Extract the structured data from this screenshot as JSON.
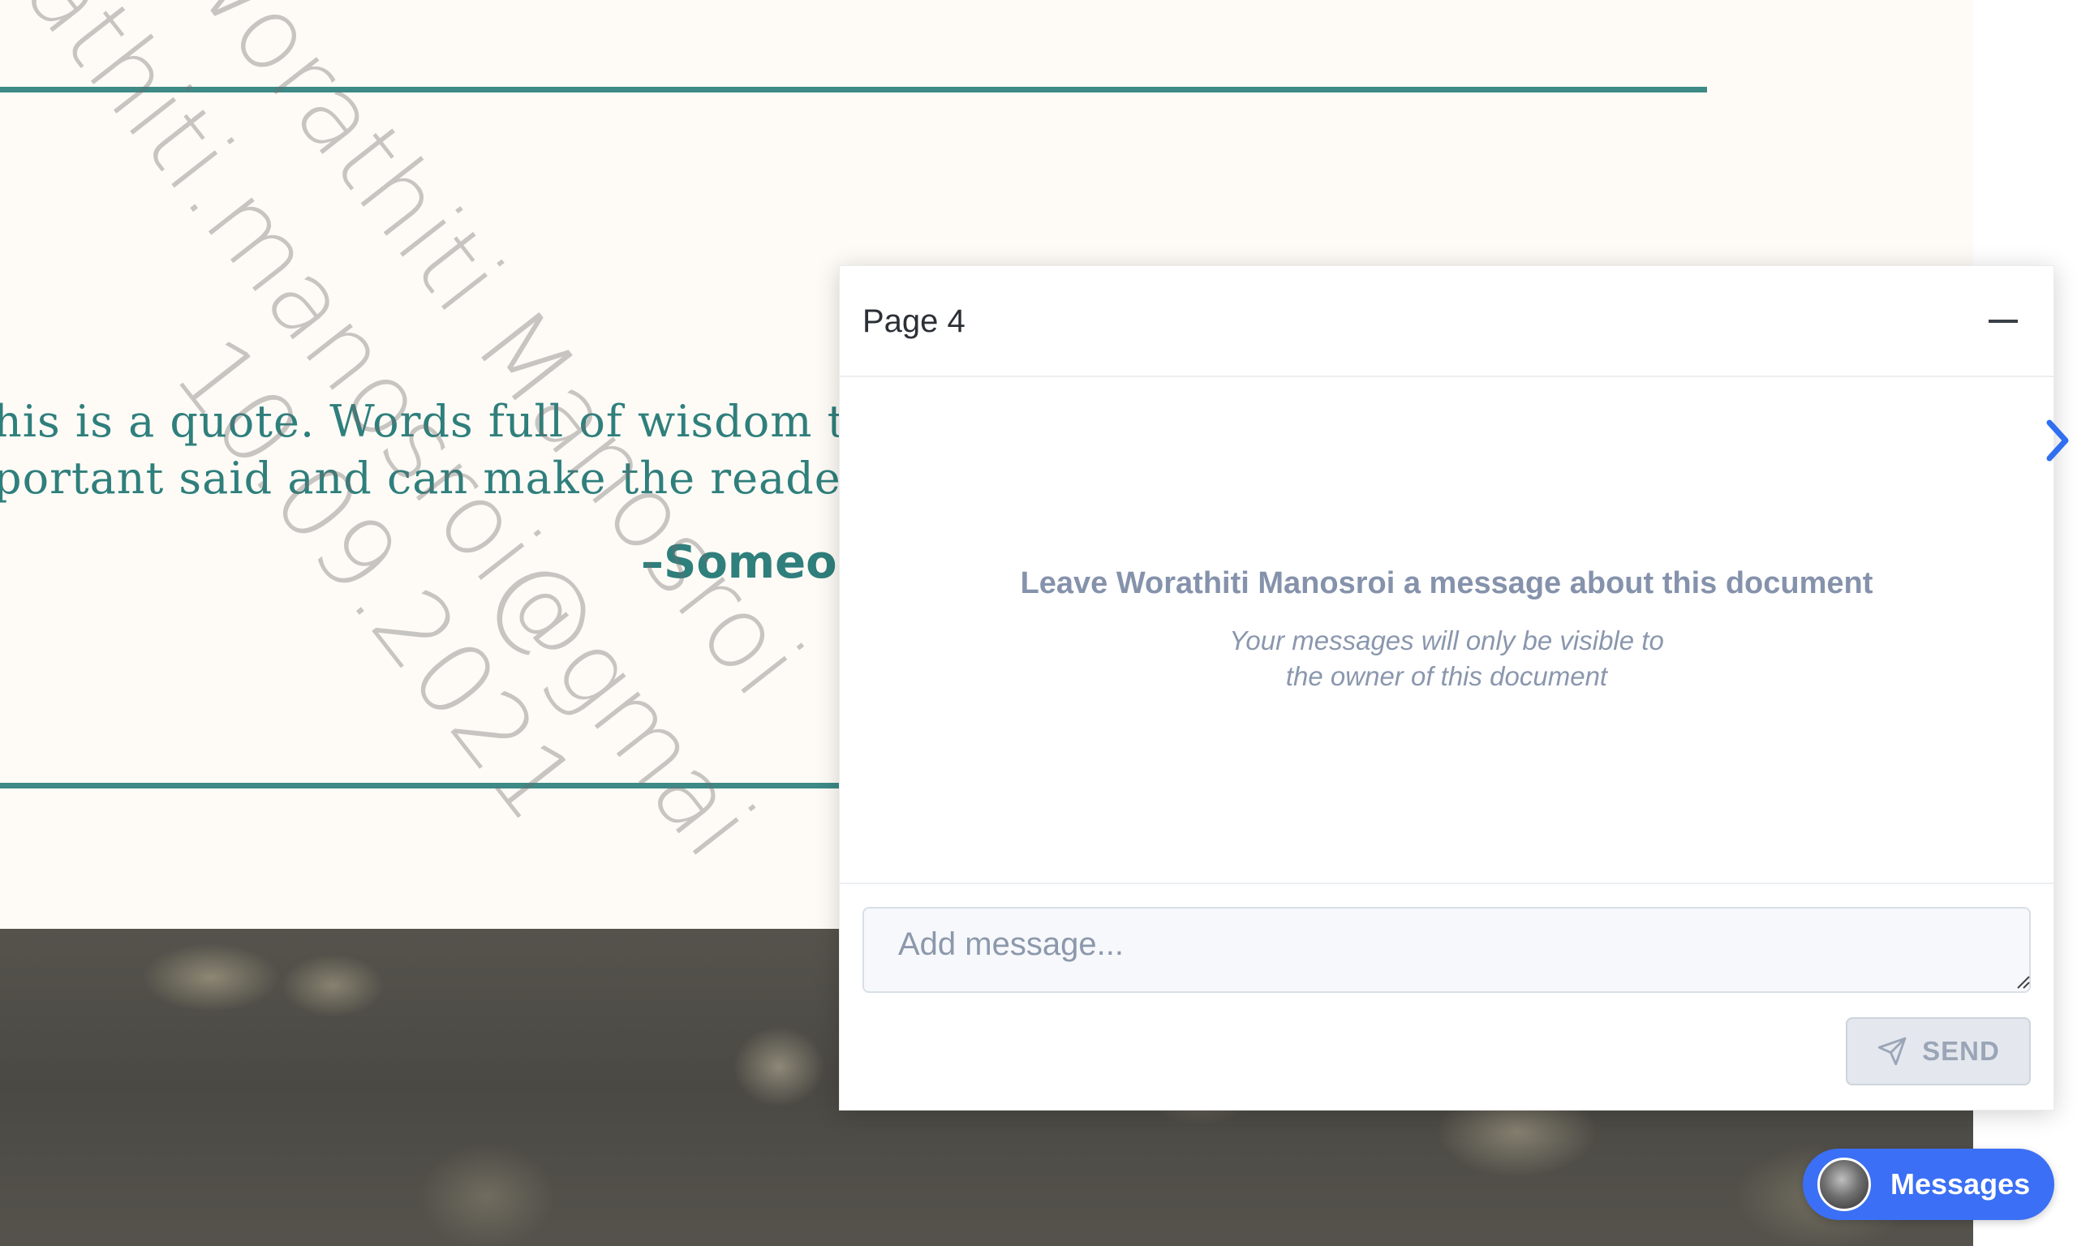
{
  "document": {
    "quote_line1": "his is a quote. Words full of wisdom that",
    "quote_line2": "portant said and can make the reader ge",
    "attribution": "–Someor",
    "watermark": {
      "line1": "Worathiti Manosroi",
      "line2": "rathiti.manosroi@gmai",
      "line3": "10.09.2021"
    },
    "accent_color": "#3d8a87"
  },
  "panel": {
    "title": "Page 4",
    "minimize_icon": "minus-icon",
    "empty_title": "Leave Worathiti Manosroi a message about this document",
    "empty_sub_line1": "Your messages will only be visible to",
    "empty_sub_line2": "the owner of this document",
    "input_placeholder": "Add message...",
    "send_label": "SEND",
    "send_icon": "paper-plane-icon",
    "next_icon": "chevron-right-icon"
  },
  "messages_button": {
    "label": "Messages",
    "color": "#3b6ff5"
  }
}
